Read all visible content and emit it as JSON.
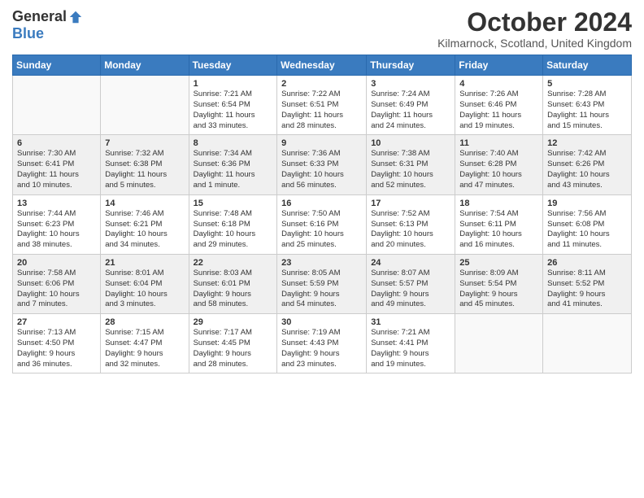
{
  "header": {
    "logo_general": "General",
    "logo_blue": "Blue",
    "month_title": "October 2024",
    "location": "Kilmarnock, Scotland, United Kingdom"
  },
  "days_of_week": [
    "Sunday",
    "Monday",
    "Tuesday",
    "Wednesday",
    "Thursday",
    "Friday",
    "Saturday"
  ],
  "weeks": [
    [
      {
        "day": "",
        "info": ""
      },
      {
        "day": "",
        "info": ""
      },
      {
        "day": "1",
        "info": "Sunrise: 7:21 AM\nSunset: 6:54 PM\nDaylight: 11 hours\nand 33 minutes."
      },
      {
        "day": "2",
        "info": "Sunrise: 7:22 AM\nSunset: 6:51 PM\nDaylight: 11 hours\nand 28 minutes."
      },
      {
        "day": "3",
        "info": "Sunrise: 7:24 AM\nSunset: 6:49 PM\nDaylight: 11 hours\nand 24 minutes."
      },
      {
        "day": "4",
        "info": "Sunrise: 7:26 AM\nSunset: 6:46 PM\nDaylight: 11 hours\nand 19 minutes."
      },
      {
        "day": "5",
        "info": "Sunrise: 7:28 AM\nSunset: 6:43 PM\nDaylight: 11 hours\nand 15 minutes."
      }
    ],
    [
      {
        "day": "6",
        "info": "Sunrise: 7:30 AM\nSunset: 6:41 PM\nDaylight: 11 hours\nand 10 minutes."
      },
      {
        "day": "7",
        "info": "Sunrise: 7:32 AM\nSunset: 6:38 PM\nDaylight: 11 hours\nand 5 minutes."
      },
      {
        "day": "8",
        "info": "Sunrise: 7:34 AM\nSunset: 6:36 PM\nDaylight: 11 hours\nand 1 minute."
      },
      {
        "day": "9",
        "info": "Sunrise: 7:36 AM\nSunset: 6:33 PM\nDaylight: 10 hours\nand 56 minutes."
      },
      {
        "day": "10",
        "info": "Sunrise: 7:38 AM\nSunset: 6:31 PM\nDaylight: 10 hours\nand 52 minutes."
      },
      {
        "day": "11",
        "info": "Sunrise: 7:40 AM\nSunset: 6:28 PM\nDaylight: 10 hours\nand 47 minutes."
      },
      {
        "day": "12",
        "info": "Sunrise: 7:42 AM\nSunset: 6:26 PM\nDaylight: 10 hours\nand 43 minutes."
      }
    ],
    [
      {
        "day": "13",
        "info": "Sunrise: 7:44 AM\nSunset: 6:23 PM\nDaylight: 10 hours\nand 38 minutes."
      },
      {
        "day": "14",
        "info": "Sunrise: 7:46 AM\nSunset: 6:21 PM\nDaylight: 10 hours\nand 34 minutes."
      },
      {
        "day": "15",
        "info": "Sunrise: 7:48 AM\nSunset: 6:18 PM\nDaylight: 10 hours\nand 29 minutes."
      },
      {
        "day": "16",
        "info": "Sunrise: 7:50 AM\nSunset: 6:16 PM\nDaylight: 10 hours\nand 25 minutes."
      },
      {
        "day": "17",
        "info": "Sunrise: 7:52 AM\nSunset: 6:13 PM\nDaylight: 10 hours\nand 20 minutes."
      },
      {
        "day": "18",
        "info": "Sunrise: 7:54 AM\nSunset: 6:11 PM\nDaylight: 10 hours\nand 16 minutes."
      },
      {
        "day": "19",
        "info": "Sunrise: 7:56 AM\nSunset: 6:08 PM\nDaylight: 10 hours\nand 11 minutes."
      }
    ],
    [
      {
        "day": "20",
        "info": "Sunrise: 7:58 AM\nSunset: 6:06 PM\nDaylight: 10 hours\nand 7 minutes."
      },
      {
        "day": "21",
        "info": "Sunrise: 8:01 AM\nSunset: 6:04 PM\nDaylight: 10 hours\nand 3 minutes."
      },
      {
        "day": "22",
        "info": "Sunrise: 8:03 AM\nSunset: 6:01 PM\nDaylight: 9 hours\nand 58 minutes."
      },
      {
        "day": "23",
        "info": "Sunrise: 8:05 AM\nSunset: 5:59 PM\nDaylight: 9 hours\nand 54 minutes."
      },
      {
        "day": "24",
        "info": "Sunrise: 8:07 AM\nSunset: 5:57 PM\nDaylight: 9 hours\nand 49 minutes."
      },
      {
        "day": "25",
        "info": "Sunrise: 8:09 AM\nSunset: 5:54 PM\nDaylight: 9 hours\nand 45 minutes."
      },
      {
        "day": "26",
        "info": "Sunrise: 8:11 AM\nSunset: 5:52 PM\nDaylight: 9 hours\nand 41 minutes."
      }
    ],
    [
      {
        "day": "27",
        "info": "Sunrise: 7:13 AM\nSunset: 4:50 PM\nDaylight: 9 hours\nand 36 minutes."
      },
      {
        "day": "28",
        "info": "Sunrise: 7:15 AM\nSunset: 4:47 PM\nDaylight: 9 hours\nand 32 minutes."
      },
      {
        "day": "29",
        "info": "Sunrise: 7:17 AM\nSunset: 4:45 PM\nDaylight: 9 hours\nand 28 minutes."
      },
      {
        "day": "30",
        "info": "Sunrise: 7:19 AM\nSunset: 4:43 PM\nDaylight: 9 hours\nand 23 minutes."
      },
      {
        "day": "31",
        "info": "Sunrise: 7:21 AM\nSunset: 4:41 PM\nDaylight: 9 hours\nand 19 minutes."
      },
      {
        "day": "",
        "info": ""
      },
      {
        "day": "",
        "info": ""
      }
    ]
  ]
}
